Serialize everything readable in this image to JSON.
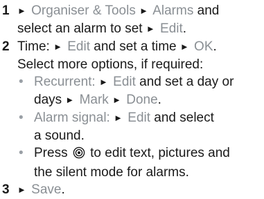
{
  "steps": [
    {
      "number": "1",
      "parts": {
        "a": "Organiser & Tools",
        "b": "Alarms",
        "c": " and",
        "d": "select an alarm to set ",
        "e": "Edit",
        "f": "."
      }
    },
    {
      "number": "2",
      "parts": {
        "a": "Time:",
        "b": "Edit",
        "c": " and set a time ",
        "d": "OK",
        "e": ".",
        "f": "Select more options, if required:"
      }
    },
    {
      "number": "3",
      "parts": {
        "a": "Save",
        "b": "."
      }
    }
  ],
  "options": [
    {
      "a": "Recurrent:",
      "b": "Edit",
      "c": " and set a day or",
      "d": "days ",
      "e": "Mark",
      "f": "Done",
      "g": "."
    },
    {
      "a": "Alarm signal:",
      "b": "Edit",
      "c": " and select",
      "d": "a sound."
    },
    {
      "a": "Press ",
      "b": " to edit text, pictures and",
      "c": "the silent mode for alarms."
    }
  ],
  "symbols": {
    "arrow": "►",
    "bullet": "•",
    "button_icon": "center-select-key-icon"
  },
  "colors": {
    "text": "#1a1a1a",
    "highlight": "#8a8f94"
  }
}
